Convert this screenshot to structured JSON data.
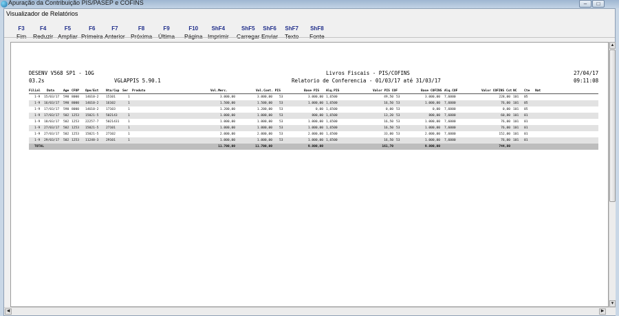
{
  "window": {
    "title": "Apuração da Contribuição PIS/PASEP e COFINS",
    "subtitle": "Visualizador de Relatórios",
    "controls": [
      "–",
      "□",
      "X"
    ]
  },
  "toolbar": [
    {
      "key": "F3",
      "label": "Fim"
    },
    {
      "key": "F4",
      "label": "Reduzir"
    },
    {
      "key": "F5",
      "label": "Ampliar"
    },
    {
      "key": "F6",
      "label": "Primeira"
    },
    {
      "key": "F7",
      "label": "Anterior"
    },
    {
      "key": "F8",
      "label": "Próxima"
    },
    {
      "key": "F9",
      "label": "Última"
    },
    {
      "key": "F10",
      "label": "Página"
    },
    {
      "key": "ShF4",
      "label": "Imprimir"
    },
    {
      "key": "ShF5",
      "label": "Carregar"
    },
    {
      "key": "ShF6",
      "label": "Enviar"
    },
    {
      "key": "ShF7",
      "label": "Texto"
    },
    {
      "key": "ShF8",
      "label": "Fonte"
    }
  ],
  "report": {
    "system": "DESENV V568 SP1 - 10G",
    "version": "03.2s",
    "program": "VGLAPPIS 5.90.1",
    "title": "Livros Fiscais - PIS/COFINS",
    "subtitle": "Relatorio de Conferencia - 01/03/17 até 31/03/17",
    "date": "27/04/17",
    "time": "09:11:08",
    "columns": [
      "Filial",
      "Data",
      "Age",
      "CFOP",
      "Ope/Est",
      "Nta/Cup",
      "Ser",
      "Produto",
      "Vol.Merc.",
      "Vol.Cont. PIS",
      "Base PIS",
      "Alq.PIS",
      "Valor PIS COF",
      "Base COFINS",
      "Alq.COF",
      "Valor COFINS Cst",
      "NC",
      "Cte",
      "Nat"
    ],
    "rows": [
      {
        "filial": "1-9",
        "data": "15/03/17",
        "age": "590",
        "cfop": "8000",
        "ope": "14610-2",
        "nta": "15101",
        "ser": "1",
        "vmerc": "3.000,00",
        "vcont": "3.000,00",
        "cst": "53",
        "bpis": "3.000,00",
        "apis": "1,6500",
        "vpis": "49,50",
        "cstc": "53",
        "bcof": "3.000,00",
        "acof": "7,6000",
        "vcof": "228,00",
        "nc": "101",
        "nat": "05"
      },
      {
        "filial": "1-9",
        "data": "16/03/17",
        "age": "590",
        "cfop": "8000",
        "ope": "14610-2",
        "nta": "16102",
        "ser": "1",
        "vmerc": "1.500,00",
        "vcont": "1.500,00",
        "cst": "53",
        "bpis": "1.000,00",
        "apis": "1,6500",
        "vpis": "16,50",
        "cstc": "53",
        "bcof": "1.000,00",
        "acof": "7,6000",
        "vcof": "76,00",
        "nc": "101",
        "nat": "05"
      },
      {
        "filial": "1-9",
        "data": "17/03/17",
        "age": "590",
        "cfop": "8000",
        "ope": "14610-2",
        "nta": "17103",
        "ser": "1",
        "vmerc": "1.200,00",
        "vcont": "1.200,00",
        "cst": "53",
        "bpis": "0,00",
        "apis": "1,6500",
        "vpis": "0,00",
        "cstc": "53",
        "bcof": "0,00",
        "acof": "7,6000",
        "vcof": "0,00",
        "nc": "101",
        "nat": "05"
      },
      {
        "filial": "1-9",
        "data": "17/03/17",
        "age": "502",
        "cfop": "1253",
        "ope": "15021-5",
        "nta": "502143",
        "ser": "1",
        "vmerc": "1.000,00",
        "vcont": "1.000,00",
        "cst": "53",
        "bpis": "800,00",
        "apis": "1,6500",
        "vpis": "13,20",
        "cstc": "53",
        "bcof": "800,00",
        "acof": "7,6000",
        "vcof": "60,80",
        "nc": "101",
        "nat": "01"
      },
      {
        "filial": "1-9",
        "data": "18/03/17",
        "age": "502",
        "cfop": "1253",
        "ope": "22257-7",
        "nta": "5021431",
        "ser": "1",
        "vmerc": "1.000,00",
        "vcont": "1.000,00",
        "cst": "53",
        "bpis": "1.000,00",
        "apis": "1,6500",
        "vpis": "16,50",
        "cstc": "53",
        "bcof": "1.000,00",
        "acof": "7,6000",
        "vcof": "76,00",
        "nc": "101",
        "nat": "01"
      },
      {
        "filial": "1-9",
        "data": "27/03/17",
        "age": "502",
        "cfop": "1253",
        "ope": "15021-5",
        "nta": "27101",
        "ser": "1",
        "vmerc": "1.000,00",
        "vcont": "1.000,00",
        "cst": "53",
        "bpis": "1.000,00",
        "apis": "1,6500",
        "vpis": "16,50",
        "cstc": "53",
        "bcof": "1.000,00",
        "acof": "7,6000",
        "vcof": "76,00",
        "nc": "101",
        "nat": "01"
      },
      {
        "filial": "1-9",
        "data": "27/03/17",
        "age": "502",
        "cfop": "1253",
        "ope": "15021-5",
        "nta": "27102",
        "ser": "1",
        "vmerc": "2.000,00",
        "vcont": "2.000,00",
        "cst": "53",
        "bpis": "2.000,00",
        "apis": "1,6500",
        "vpis": "33,00",
        "cstc": "53",
        "bcof": "2.000,00",
        "acof": "7,6000",
        "vcof": "152,00",
        "nc": "101",
        "nat": "01"
      },
      {
        "filial": "1-9",
        "data": "29/03/17",
        "age": "502",
        "cfop": "1253",
        "ope": "11248-3",
        "nta": "29101",
        "ser": "1",
        "vmerc": "1.000,00",
        "vcont": "1.000,00",
        "cst": "53",
        "bpis": "1.000,00",
        "apis": "1,6500",
        "vpis": "16,50",
        "cstc": "53",
        "bcof": "1.000,00",
        "acof": "7,6000",
        "vcof": "76,00",
        "nc": "101",
        "nat": "01"
      }
    ],
    "total": {
      "label": "TOTAL",
      "vmerc": "11.700,00",
      "vcont": "11.700,00",
      "bpis": "9.800,00",
      "vpis": "161,70",
      "bcof": "9.800,00",
      "vcof": "744,80"
    }
  },
  "scroll": {
    "up": "▲",
    "down": "▼",
    "left": "◀",
    "right": "▶"
  }
}
